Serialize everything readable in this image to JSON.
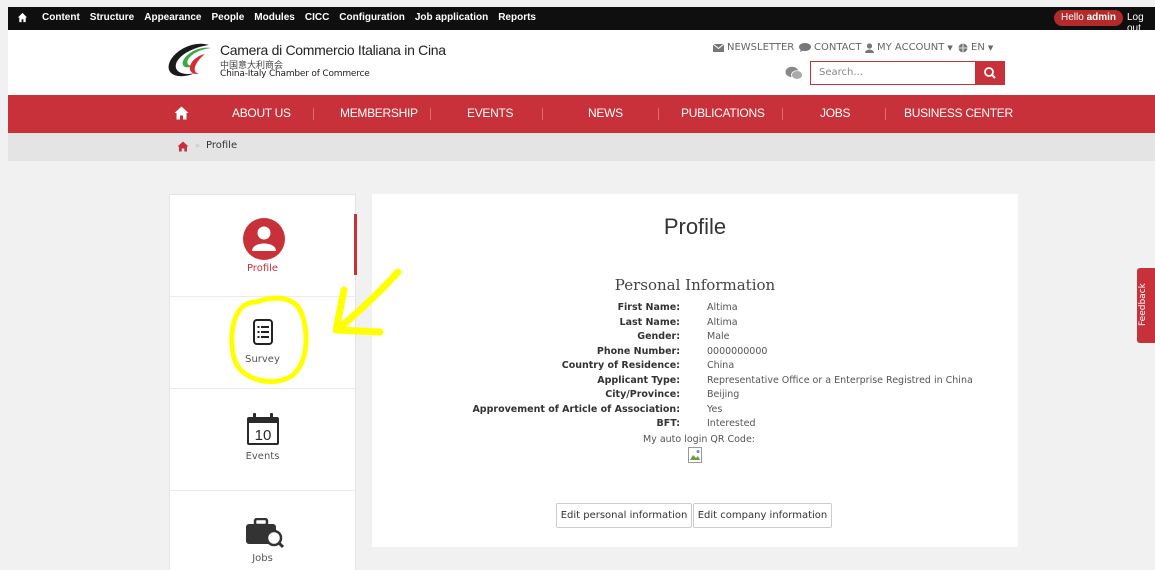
{
  "admin_bar": {
    "menu": [
      "Content",
      "Structure",
      "Appearance",
      "People",
      "Modules",
      "CICC",
      "Configuration",
      "Job application",
      "Reports"
    ],
    "hello_prefix": "Hello ",
    "hello_user": "admin",
    "logout": "Log out"
  },
  "header": {
    "logo_line1": "Camera di Commercio Italiana in Cina",
    "logo_line2": "中国意大利商会",
    "logo_line3": "China-Italy Chamber of Commerce",
    "newsletter": "NEWSLETTER",
    "contact": "CONTACT",
    "my_account": "MY ACCOUNT",
    "language": "EN",
    "search_placeholder": "Search..."
  },
  "nav": {
    "items": [
      "ABOUT US",
      "MEMBERSHIP",
      "EVENTS",
      "NEWS",
      "PUBLICATIONS",
      "JOBS",
      "BUSINESS CENTER"
    ]
  },
  "breadcrumb": {
    "current": "Profile"
  },
  "sidemenu": {
    "items": [
      {
        "label": "Profile",
        "icon": "user-circle-icon",
        "active": true
      },
      {
        "label": "Survey",
        "icon": "survey-list-icon",
        "active": false
      },
      {
        "label": "Events",
        "icon": "calendar-icon",
        "active": false,
        "calendar_day": "10"
      },
      {
        "label": "Jobs",
        "icon": "briefcase-search-icon",
        "active": false
      }
    ]
  },
  "profile": {
    "title": "Profile",
    "section_title": "Personal Information",
    "fields": [
      {
        "label": "First Name:",
        "value": "Altima"
      },
      {
        "label": "Last Name:",
        "value": "Altima"
      },
      {
        "label": "Gender:",
        "value": "Male"
      },
      {
        "label": "Phone Number:",
        "value": "0000000000"
      },
      {
        "label": "Country of Residence:",
        "value": "China"
      },
      {
        "label": "Applicant Type:",
        "value": "Representative Office or a Enterprise Registred in China"
      },
      {
        "label": "City/Province:",
        "value": "Beijing"
      },
      {
        "label": "Approvement of Article of Association:",
        "value": "Yes"
      },
      {
        "label": "BFT:",
        "value": "Interested"
      }
    ],
    "qr_label": "My auto login QR Code:",
    "edit_personal": "Edit personal information",
    "edit_company": "Edit company information"
  },
  "feedback": {
    "label": "Feedback"
  },
  "colors": {
    "brand_red": "#c9313a",
    "admin_bar": "#0f0f0f",
    "annotation_yellow": "#ffff00"
  }
}
